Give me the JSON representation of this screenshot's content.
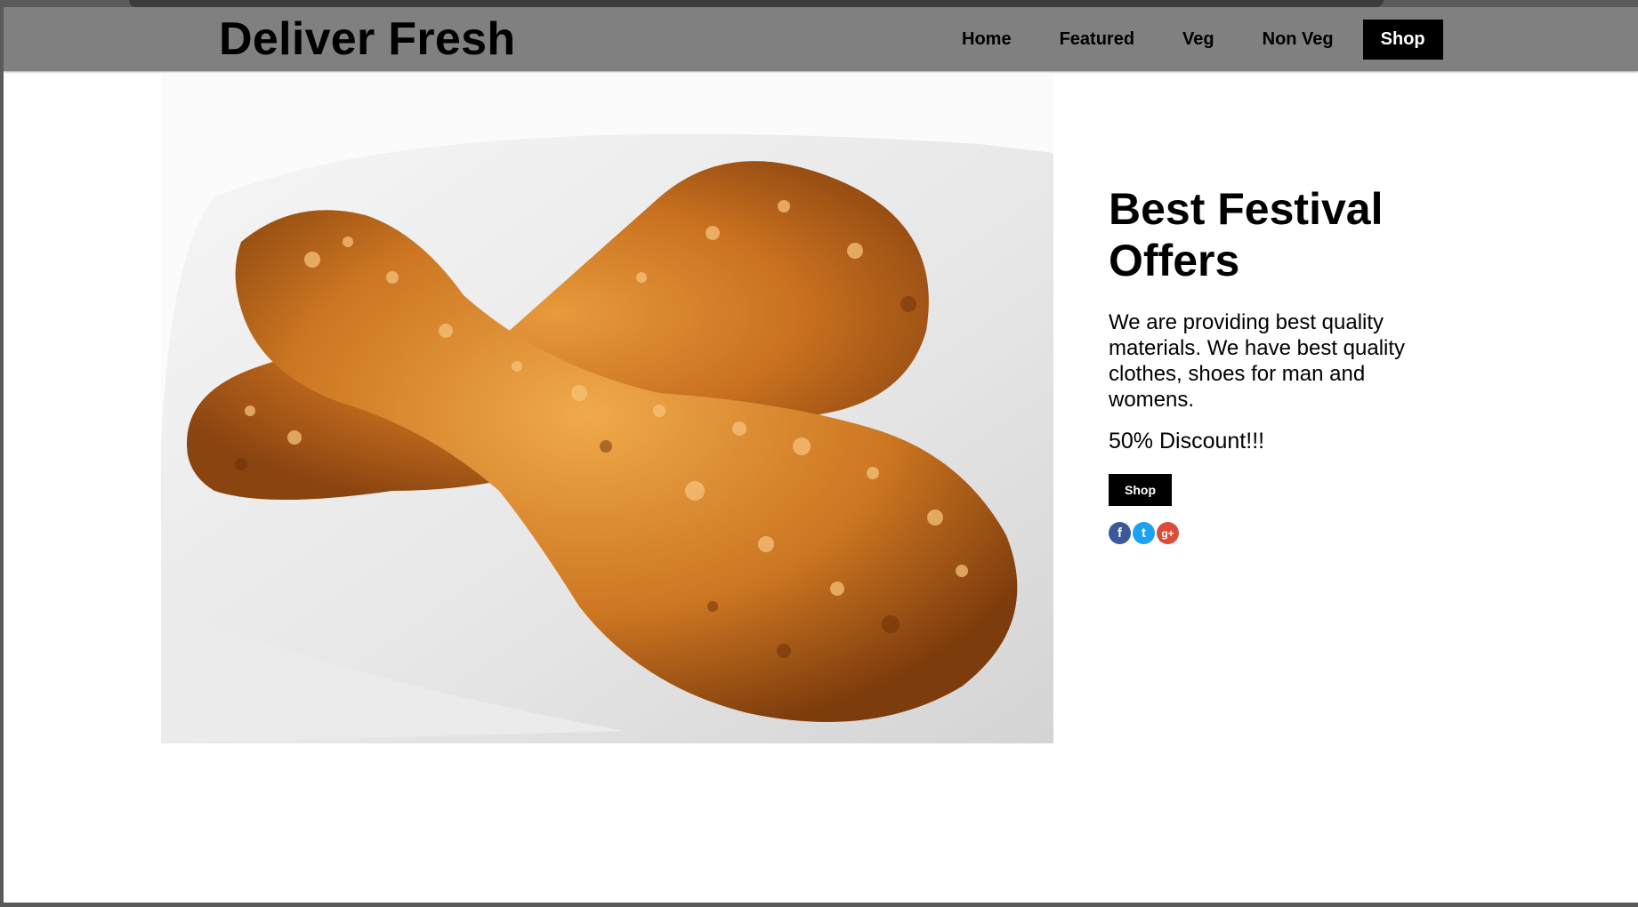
{
  "header": {
    "brand": "Deliver Fresh",
    "nav": [
      {
        "label": "Home"
      },
      {
        "label": "Featured"
      },
      {
        "label": "Veg"
      },
      {
        "label": "Non Veg"
      },
      {
        "label": "Shop",
        "active": true
      }
    ]
  },
  "hero": {
    "image_subject": "fried chicken drumsticks on white plate"
  },
  "offer": {
    "title": "Best Festival Offers",
    "description": "We are providing best quality materials. We have best quality clothes, shoes for man and womens.",
    "discount": "50% Discount!!!",
    "shop_button": "Shop"
  },
  "social": [
    {
      "name": "facebook-icon",
      "glyph": "f",
      "color": "#3b5998"
    },
    {
      "name": "twitter-icon",
      "glyph": "t",
      "color": "#1da1f2"
    },
    {
      "name": "google-plus-icon",
      "glyph": "g+",
      "color": "#dd4b39"
    }
  ],
  "colors": {
    "header_bg": "#808080",
    "active_nav_bg": "#000000",
    "page_bg": "#ffffff"
  }
}
